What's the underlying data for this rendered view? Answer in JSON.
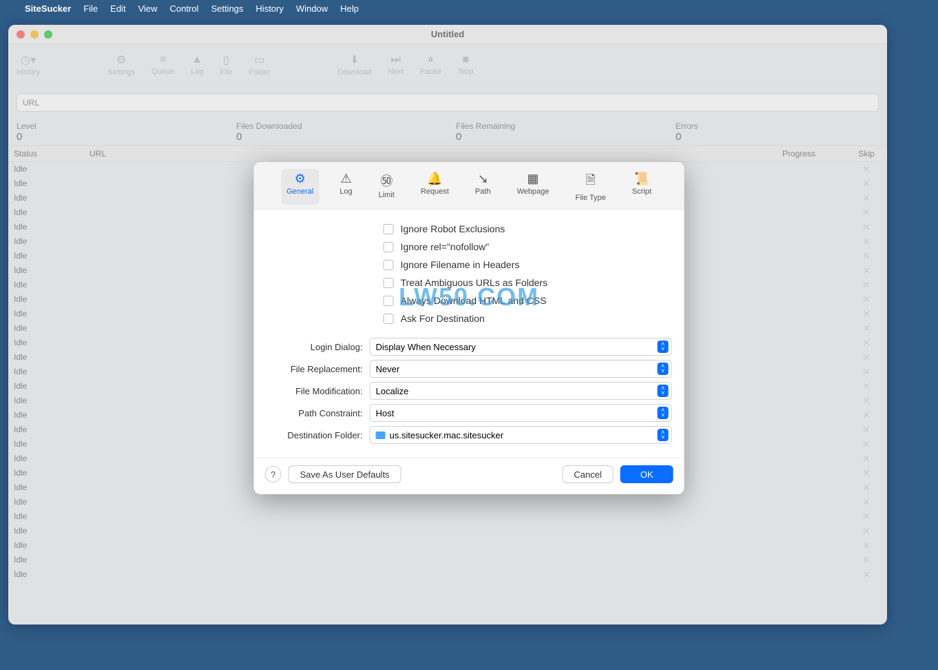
{
  "menubar": {
    "app": "SiteSucker",
    "items": [
      "File",
      "Edit",
      "View",
      "Control",
      "Settings",
      "History",
      "Window",
      "Help"
    ]
  },
  "window": {
    "title": "Untitled",
    "toolbar": {
      "history": "History",
      "settings": "Settings",
      "queue": "Queue",
      "log": "Log",
      "file": "File",
      "folder": "Folder",
      "download": "Download",
      "next": "Next",
      "pause": "Pause",
      "stop": "Stop"
    },
    "url_placeholder": "URL",
    "stats": {
      "level_label": "Level",
      "level_value": "0",
      "downloaded_label": "Files Downloaded",
      "downloaded_value": "0",
      "remaining_label": "Files Remaining",
      "remaining_value": "0",
      "errors_label": "Errors",
      "errors_value": "0"
    },
    "columns": {
      "status": "Status",
      "url": "URL",
      "progress": "Progress",
      "skip": "Skip"
    },
    "row_status": "Idle",
    "row_count": 29
  },
  "modal": {
    "tabs": {
      "general": "General",
      "log": "Log",
      "limit": "Limit",
      "request": "Request",
      "path": "Path",
      "webpage": "Webpage",
      "filetype": "File Type",
      "script": "Script"
    },
    "checks": {
      "robot": "Ignore Robot Exclusions",
      "nofollow": "Ignore rel=\"nofollow\"",
      "filename": "Ignore Filename in Headers",
      "ambiguous": "Treat Ambiguous URLs as Folders",
      "htmlcss": "Always Download HTML and CSS",
      "askdest": "Ask For Destination"
    },
    "fields": {
      "login_label": "Login Dialog:",
      "login_value": "Display When Necessary",
      "replace_label": "File Replacement:",
      "replace_value": "Never",
      "modify_label": "File Modification:",
      "modify_value": "Localize",
      "path_label": "Path Constraint:",
      "path_value": "Host",
      "dest_label": "Destination Folder:",
      "dest_value": "us.sitesucker.mac.sitesucker"
    },
    "footer": {
      "save_defaults": "Save As User Defaults",
      "cancel": "Cancel",
      "ok": "OK"
    }
  },
  "watermark": "LW50.COM"
}
